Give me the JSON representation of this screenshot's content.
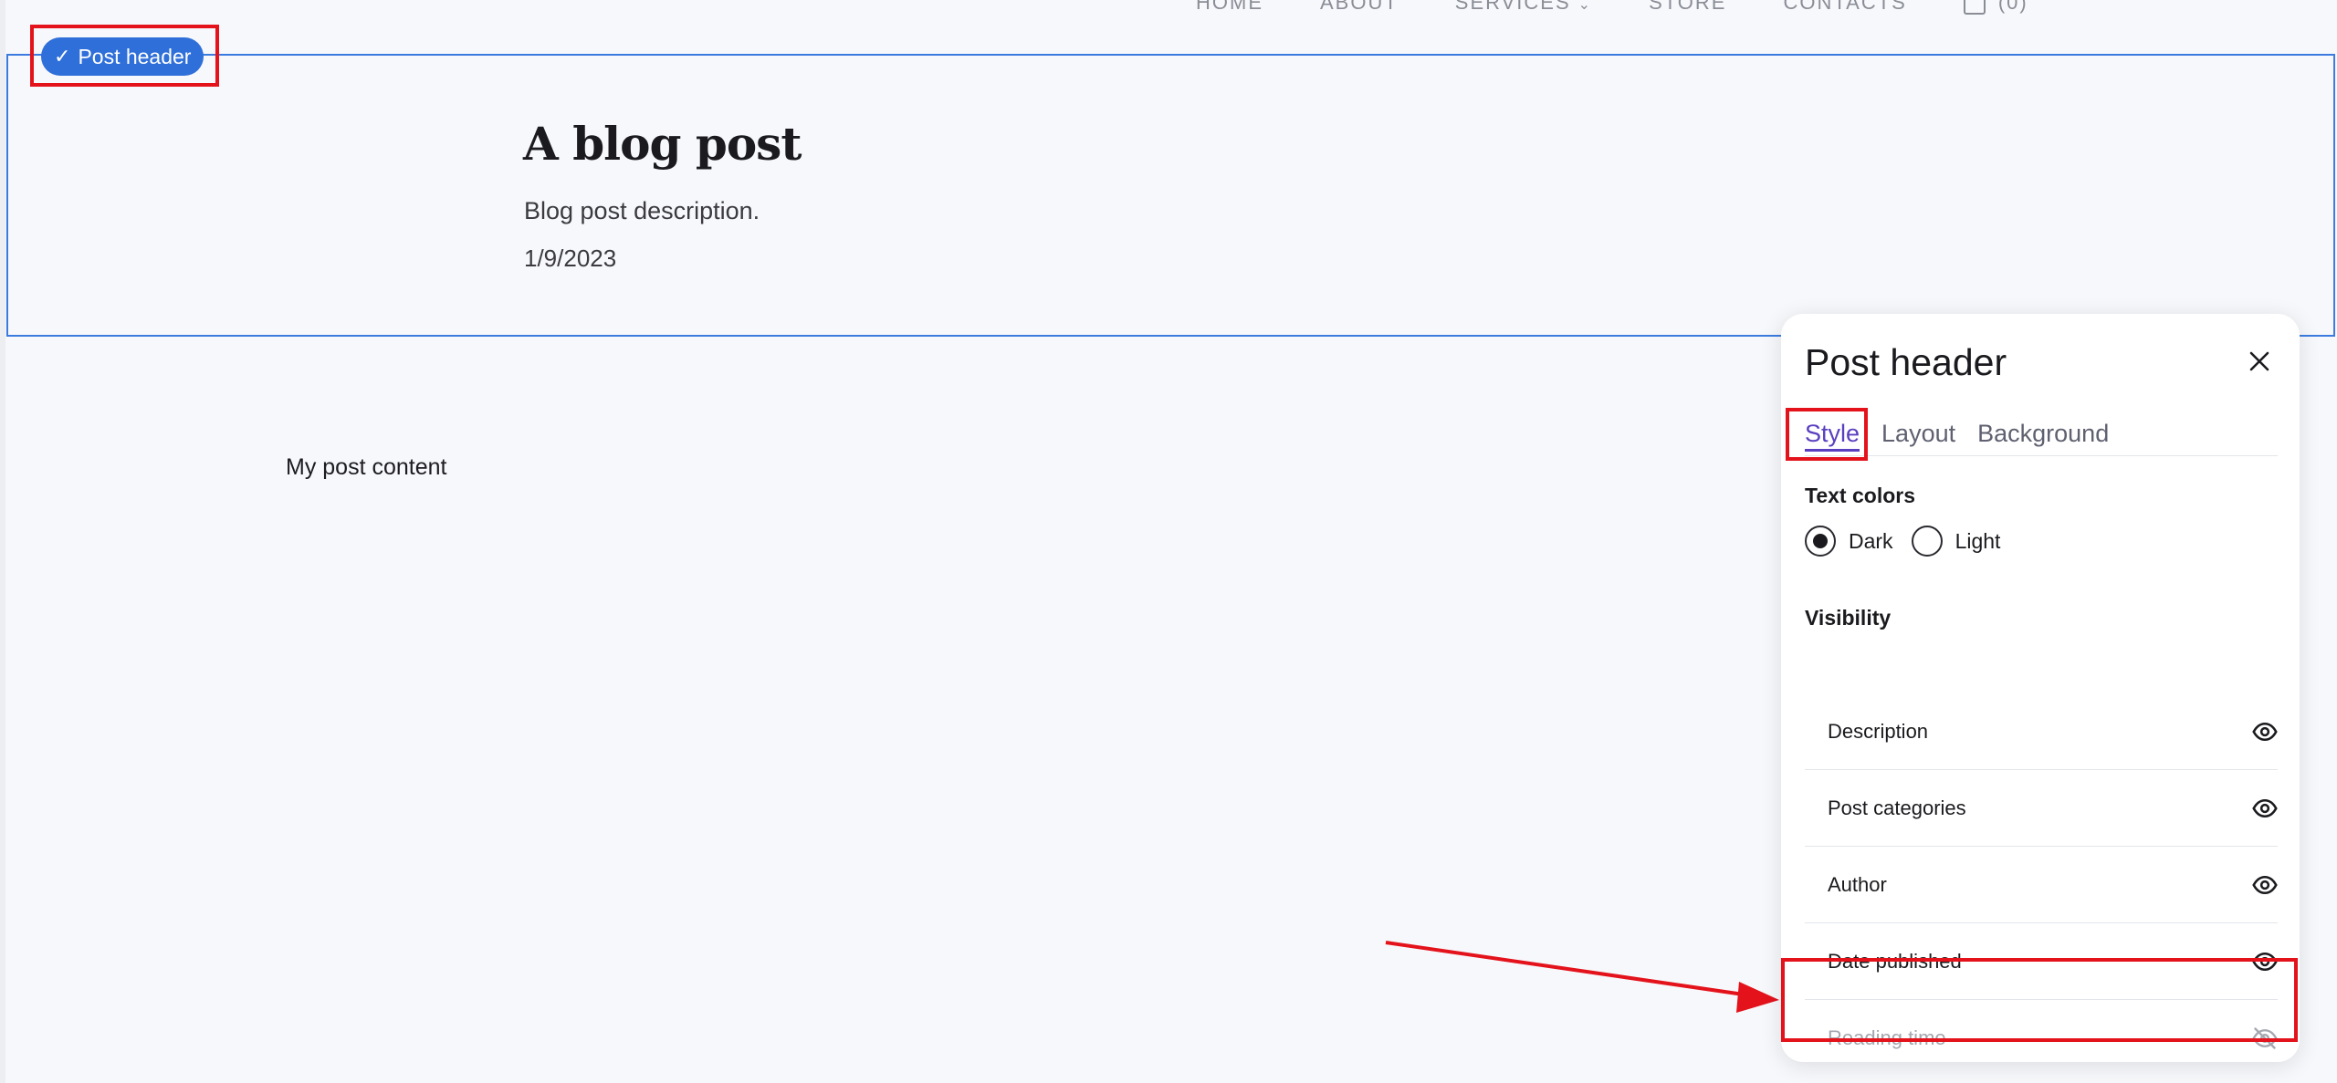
{
  "nav": {
    "items": [
      "HOME",
      "ABOUT",
      "SERVICES",
      "STORE",
      "CONTACTS"
    ],
    "cart_count": "(0)"
  },
  "post_header": {
    "badge_label": "Post header",
    "title": "A blog post",
    "description": "Blog post description.",
    "date": "1/9/2023"
  },
  "post_content": "My post content",
  "panel": {
    "title": "Post header",
    "tabs": [
      {
        "label": "Style",
        "active": true
      },
      {
        "label": "Layout",
        "active": false
      },
      {
        "label": "Background",
        "active": false
      }
    ],
    "text_colors": {
      "label": "Text colors",
      "options": [
        {
          "label": "Dark",
          "checked": true
        },
        {
          "label": "Light",
          "checked": false
        }
      ]
    },
    "visibility": {
      "label": "Visibility",
      "items": [
        {
          "label": "Description",
          "visible": true
        },
        {
          "label": "Post categories",
          "visible": true
        },
        {
          "label": "Author",
          "visible": true
        },
        {
          "label": "Date published",
          "visible": true
        },
        {
          "label": "Reading time",
          "visible": false
        }
      ]
    }
  },
  "colors": {
    "accent": "#5a3fc0",
    "selection_blue": "#2f6fd9",
    "annotation_red": "#e3121b"
  }
}
